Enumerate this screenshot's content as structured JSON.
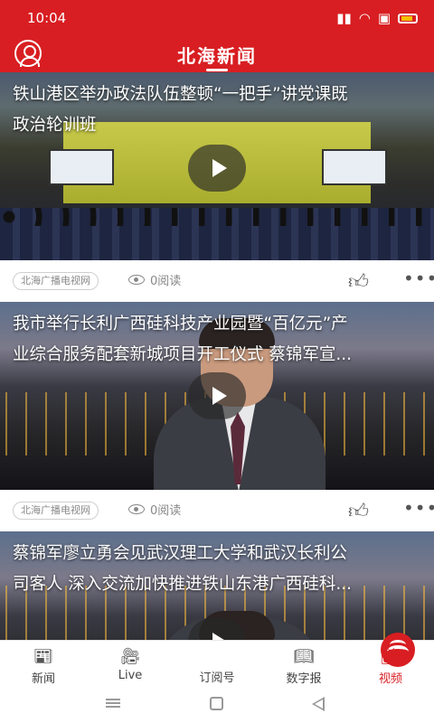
{
  "status": {
    "time": "10:04"
  },
  "header": {
    "title": "北海新闻"
  },
  "feed": [
    {
      "title_lines": [
        "铁山港区举办政法队伍整顿“一把手”讲党课既",
        "政治轮训班"
      ],
      "source": "北海广播电视网",
      "views": "0阅读"
    },
    {
      "title_lines": [
        "我市举行长利广西硅科技产业园暨“百亿元”产",
        "业综合服务配套新城项目开工仪式 蔡锦军宣..."
      ],
      "source": "北海广播电视网",
      "views": "0阅读"
    },
    {
      "title_lines": [
        "蔡锦军廖立勇会见武汉理工大学和武汉长利公",
        "司客人 深入交流加快推进铁山东港广西硅科..."
      ]
    }
  ],
  "tabs": [
    {
      "label": "新闻",
      "icon": "news-icon"
    },
    {
      "label": "Live",
      "icon": "camera-icon"
    },
    {
      "label": "订阅号",
      "icon": "logo-icon"
    },
    {
      "label": "数字报",
      "icon": "book-icon"
    },
    {
      "label": "视频",
      "icon": "tv-icon",
      "active": true
    }
  ],
  "colors": {
    "brand": "#d81e22"
  }
}
